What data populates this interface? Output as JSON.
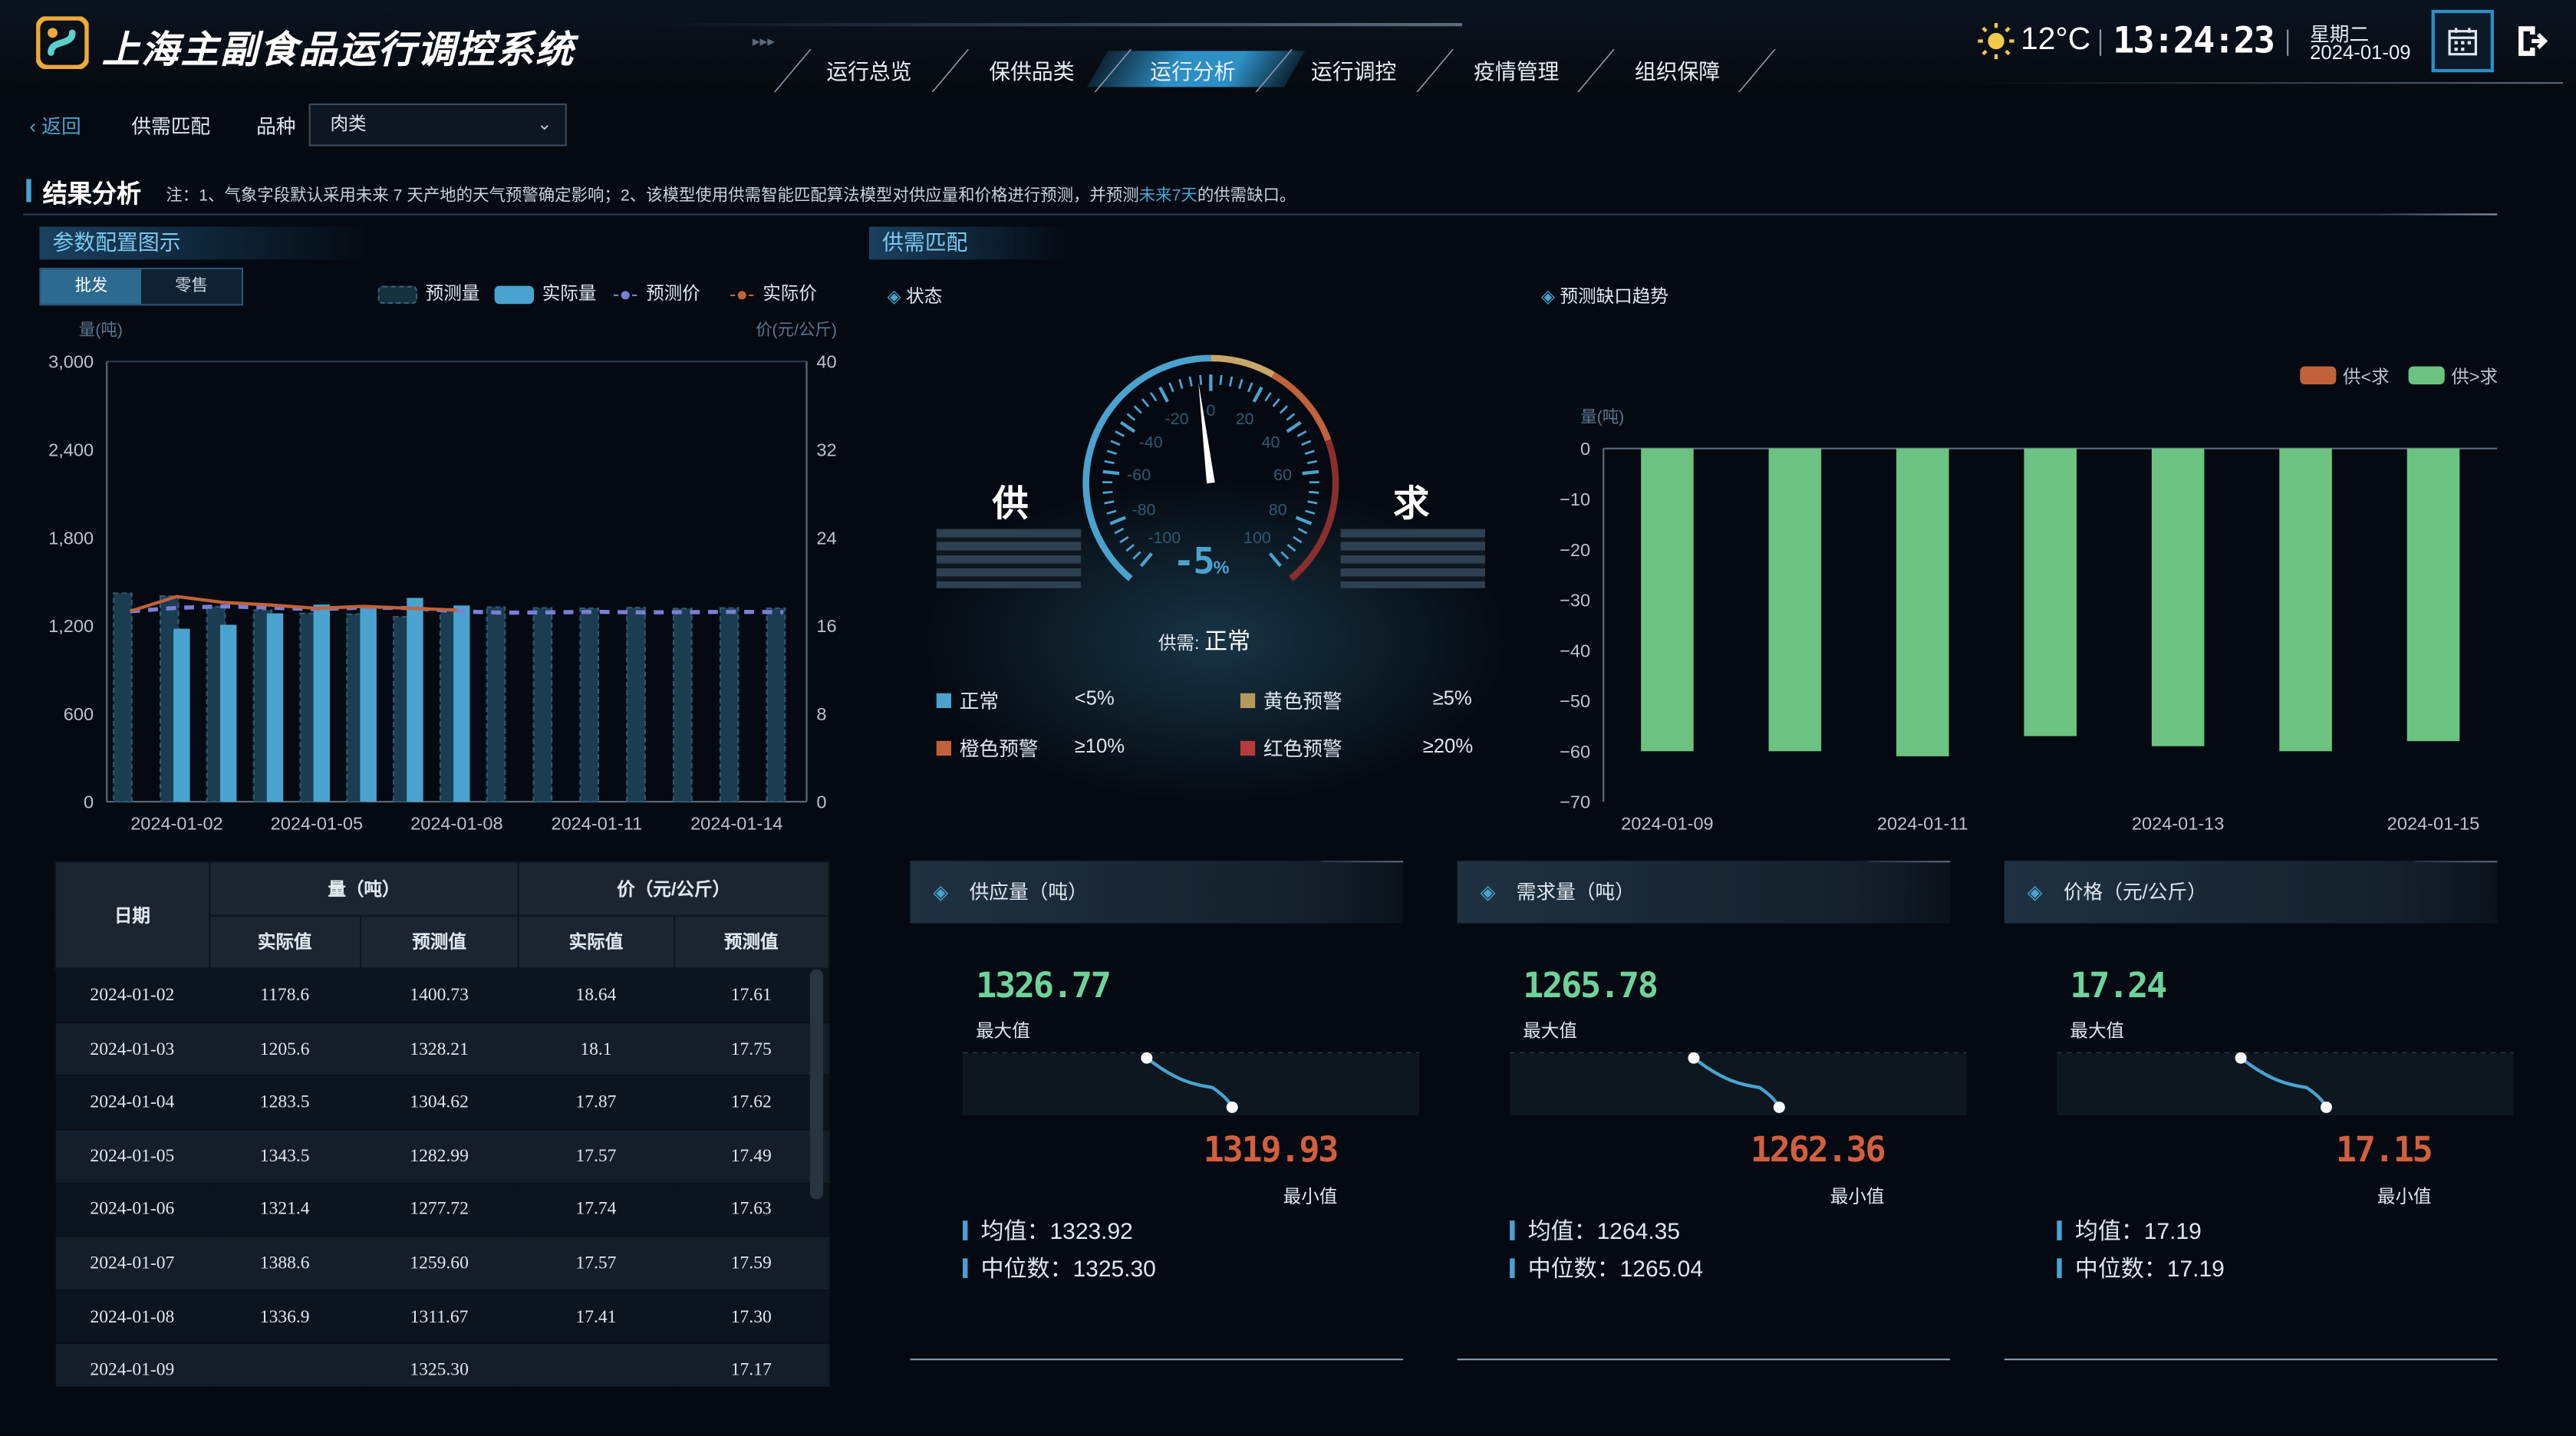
{
  "header": {
    "title": "上海主副食品运行调控系统",
    "nav": [
      "运行总览",
      "保供品类",
      "运行分析",
      "运行调控",
      "疫情管理",
      "组织保障"
    ],
    "active_nav": "运行分析",
    "temperature": "12°C",
    "time": "13:24:23",
    "weekday": "星期二",
    "date": "2024-01-09"
  },
  "toolbar": {
    "back": "返回",
    "section": "供需匹配",
    "variety_label": "品种",
    "variety_value": "肉类"
  },
  "result": {
    "title": "结果分析",
    "note_prefix": "注：1、气象字段默认采用未来 7 天产地的天气预警确定影响；2、该模型使用供需智能匹配算法模型对供应量和价格进行预测，并预测",
    "note_highlight": "未来7天",
    "note_suffix": "的供需缺口。"
  },
  "param_panel": {
    "title": "参数配置图示",
    "tabs": [
      "批发",
      "零售"
    ],
    "active_tab": "批发",
    "legend": [
      "预测量",
      "实际量",
      "预测价",
      "实际价"
    ],
    "y_left_unit": "量(吨)",
    "y_right_unit": "价(元/公斤)"
  },
  "chart_data": [
    {
      "type": "bar",
      "x": [
        "2024-01-01",
        "2024-01-02",
        "2024-01-03",
        "2024-01-04",
        "2024-01-05",
        "2024-01-06",
        "2024-01-07",
        "2024-01-08",
        "2024-01-09",
        "2024-01-10",
        "2024-01-11",
        "2024-01-12",
        "2024-01-13",
        "2024-01-14",
        "2024-01-15"
      ],
      "x_ticks": [
        "2024-01-02",
        "2024-01-05",
        "2024-01-08",
        "2024-01-11",
        "2024-01-14"
      ],
      "series": [
        {
          "name": "预测量",
          "kind": "bar",
          "values": [
            1420,
            1400.73,
            1328.21,
            1304.62,
            1282.99,
            1277.72,
            1259.6,
            1311.67,
            1325.3,
            1320,
            1318,
            1322,
            1316,
            1320,
            1318
          ]
        },
        {
          "name": "实际量",
          "kind": "bar",
          "values": [
            null,
            1178.6,
            1205.6,
            1283.5,
            1343.5,
            1321.4,
            1388.6,
            1336.9,
            null,
            null,
            null,
            null,
            null,
            null,
            null
          ]
        },
        {
          "name": "预测价",
          "kind": "line",
          "values": [
            17.3,
            17.61,
            17.75,
            17.62,
            17.49,
            17.63,
            17.59,
            17.3,
            17.17,
            17.2,
            17.25,
            17.2,
            17.22,
            17.25,
            17.22
          ]
        },
        {
          "name": "实际价",
          "kind": "line",
          "values": [
            null,
            18.64,
            18.1,
            17.87,
            17.57,
            17.74,
            17.57,
            17.41,
            null,
            null,
            null,
            null,
            null,
            null,
            null
          ]
        }
      ],
      "ylim": [
        0,
        3000
      ],
      "y_ticks": [
        "0",
        "600",
        "1,200",
        "1,800",
        "2,400",
        "3,000"
      ],
      "y2lim": [
        0,
        40
      ],
      "y2_ticks": [
        "0",
        "8",
        "16",
        "24",
        "32",
        "40"
      ],
      "colors": {
        "forecast_bar": "#1a3d52",
        "actual_bar": "#4aa3cf",
        "forecast_price": "#7b7fd6",
        "actual_price": "#c1623a"
      }
    },
    {
      "type": "bar",
      "x": [
        "2024-01-09",
        "2024-01-10",
        "2024-01-11",
        "2024-01-12",
        "2024-01-13",
        "2024-01-14",
        "2024-01-15"
      ],
      "x_ticks": [
        "2024-01-09",
        "2024-01-11",
        "2024-01-13",
        "2024-01-15"
      ],
      "values": [
        -60,
        -60,
        -61,
        -57,
        -59,
        -60,
        -58
      ],
      "ylim": [
        -70,
        0
      ],
      "y_ticks": [
        "0",
        "−10",
        "−20",
        "−30",
        "−40",
        "−50",
        "−60",
        "−70"
      ],
      "y_unit": "量(吨)",
      "legend": [
        "供<求",
        "供>求"
      ],
      "colors": {
        "short": "#c1623a",
        "surplus": "#6cc281"
      }
    }
  ],
  "table": {
    "date_header": "日期",
    "qty_header": "量（吨）",
    "price_header": "价（元/公斤）",
    "sub_headers": [
      "实际值",
      "预测值",
      "实际值",
      "预测值"
    ],
    "rows": [
      [
        "2024-01-02",
        "1178.6",
        "1400.73",
        "18.64",
        "17.61"
      ],
      [
        "2024-01-03",
        "1205.6",
        "1328.21",
        "18.1",
        "17.75"
      ],
      [
        "2024-01-04",
        "1283.5",
        "1304.62",
        "17.87",
        "17.62"
      ],
      [
        "2024-01-05",
        "1343.5",
        "1282.99",
        "17.57",
        "17.49"
      ],
      [
        "2024-01-06",
        "1321.4",
        "1277.72",
        "17.74",
        "17.63"
      ],
      [
        "2024-01-07",
        "1388.6",
        "1259.60",
        "17.57",
        "17.59"
      ],
      [
        "2024-01-08",
        "1336.9",
        "1311.67",
        "17.41",
        "17.30"
      ],
      [
        "2024-01-09",
        "",
        "1325.30",
        "",
        "17.17"
      ]
    ]
  },
  "match_panel": {
    "title": "供需匹配",
    "status_label": "状态",
    "trend_label": "预测缺口趋势",
    "supply": "供",
    "demand": "求",
    "gauge_value": "-5",
    "gauge_unit": "%",
    "gauge_ticks": [
      "-100",
      "-80",
      "-60",
      "-40",
      "-20",
      "0",
      "20",
      "40",
      "60",
      "80",
      "100"
    ],
    "status_text_label": "供需:",
    "status_text": "正常",
    "levels": [
      {
        "name": "正常",
        "range": "<5%",
        "color": "#4aa3cf"
      },
      {
        "name": "黄色预警",
        "range": "≥5%",
        "color": "#b59a5a"
      },
      {
        "name": "橙色预警",
        "range": "≥10%",
        "color": "#c1623a"
      },
      {
        "name": "红色预警",
        "range": "≥20%",
        "color": "#b83a3a"
      }
    ]
  },
  "stats": [
    {
      "title": "供应量（吨）",
      "max": "1326.77",
      "max_label": "最大值",
      "min": "1319.93",
      "min_label": "最小值",
      "avg": "均值：1323.92",
      "median": "中位数：1325.30"
    },
    {
      "title": "需求量（吨）",
      "max": "1265.78",
      "max_label": "最大值",
      "min": "1262.36",
      "min_label": "最小值",
      "avg": "均值：1264.35",
      "median": "中位数：1265.04"
    },
    {
      "title": "价格（元/公斤）",
      "max": "17.24",
      "max_label": "最大值",
      "min": "17.15",
      "min_label": "最小值",
      "avg": "均值：17.19",
      "median": "中位数：17.19"
    }
  ]
}
